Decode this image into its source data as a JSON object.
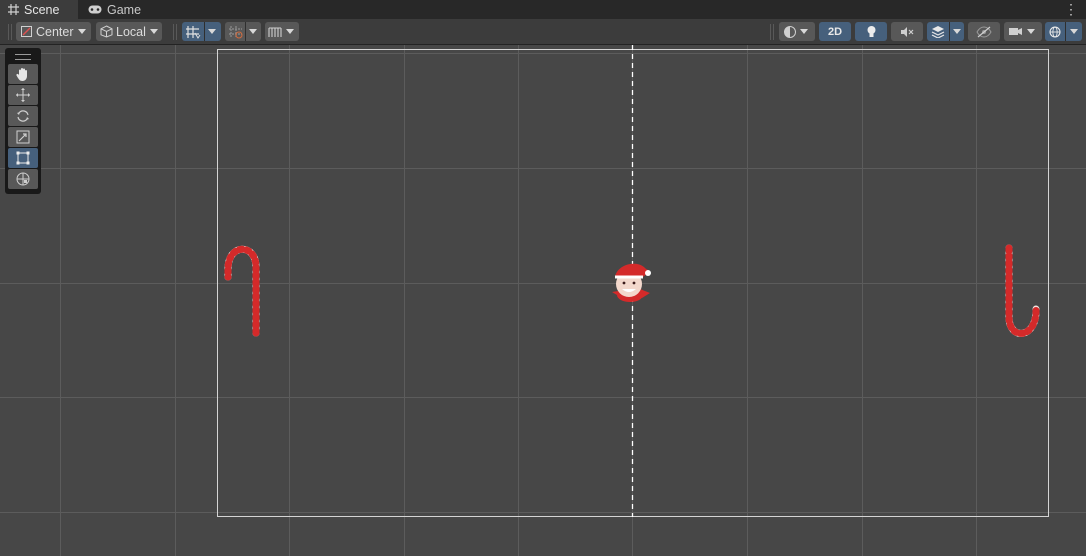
{
  "tabs": [
    {
      "label": "Scene",
      "icon": "grid-icon",
      "active": true
    },
    {
      "label": "Game",
      "icon": "gamepad-icon",
      "active": false
    }
  ],
  "toolbar": {
    "pivot_label": "Center",
    "handle_label": "Local",
    "two_d_label": "2D"
  },
  "tools": [
    "hand-tool-icon",
    "move-tool-icon",
    "rotate-tool-icon",
    "scale-tool-icon",
    "rect-tool-icon",
    "transform-tool-icon"
  ],
  "active_tool": "rect-tool-icon",
  "scene_objects": [
    "candy-cane-left",
    "santa-player",
    "candy-cane-right"
  ],
  "colors": {
    "background": "#474747",
    "toolbar": "#3c3c3c",
    "active_blue": "#46607c",
    "candy_red": "#d42a2a"
  }
}
